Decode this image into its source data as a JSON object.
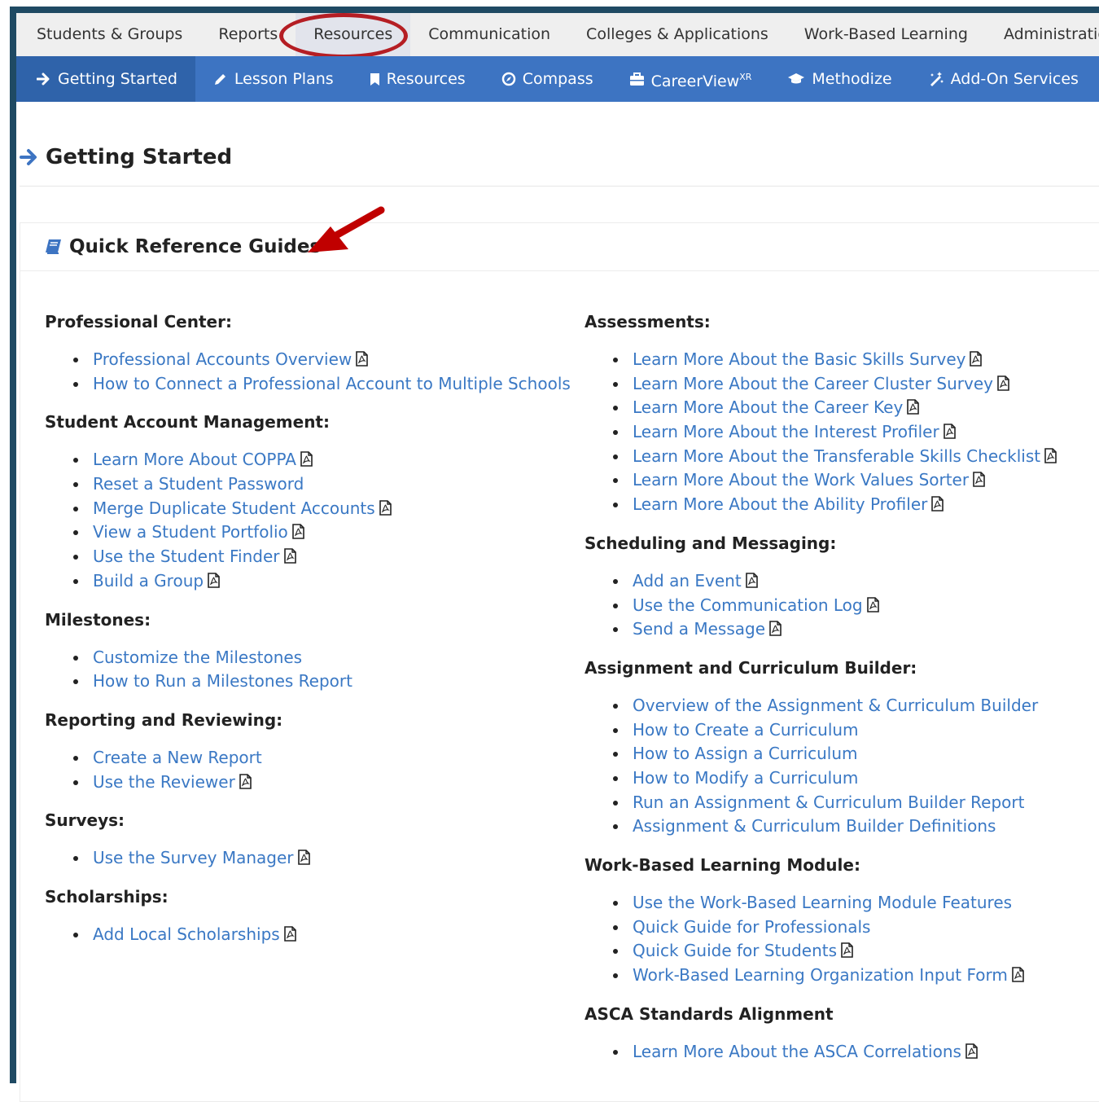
{
  "top_nav": [
    "Students & Groups",
    "Reports",
    "Resources",
    "Communication",
    "Colleges & Applications",
    "Work-Based Learning",
    "Administration"
  ],
  "sub_nav": [
    {
      "label": "Getting Started",
      "icon": "arrow-right-icon"
    },
    {
      "label": "Lesson Plans",
      "icon": "pencil-icon"
    },
    {
      "label": "Resources",
      "icon": "bookmark-icon"
    },
    {
      "label": "Compass",
      "icon": "compass-icon"
    },
    {
      "label": "CareerView",
      "sup": "XR",
      "icon": "briefcase-icon"
    },
    {
      "label": "Methodize",
      "icon": "graduation-cap-icon"
    },
    {
      "label": "Add-On Services",
      "icon": "magic-wand-icon"
    }
  ],
  "page_title": "Getting Started",
  "panel_title": "Quick Reference Guides",
  "colors": {
    "frame": "#1f4a63",
    "subnav": "#3d74c2",
    "link": "#3a78c4",
    "annotation": "#b51e24"
  },
  "left_sections": [
    {
      "heading": "Professional Center:",
      "items": [
        {
          "text": "Professional Accounts Overview",
          "pdf": true
        },
        {
          "text": "How to Connect a Professional Account to Multiple Schools",
          "pdf": false
        }
      ]
    },
    {
      "heading": "Student Account Management:",
      "items": [
        {
          "text": "Learn More About COPPA",
          "pdf": true
        },
        {
          "text": "Reset a Student Password",
          "pdf": false
        },
        {
          "text": "Merge Duplicate Student Accounts",
          "pdf": true
        },
        {
          "text": "View a Student Portfolio",
          "pdf": true
        },
        {
          "text": "Use the Student Finder",
          "pdf": true
        },
        {
          "text": "Build a Group",
          "pdf": true
        }
      ]
    },
    {
      "heading": "Milestones:",
      "items": [
        {
          "text": "Customize the Milestones",
          "pdf": false
        },
        {
          "text": "How to Run a Milestones Report",
          "pdf": false
        }
      ]
    },
    {
      "heading": "Reporting and Reviewing:",
      "items": [
        {
          "text": "Create a New Report",
          "pdf": false
        },
        {
          "text": "Use the Reviewer",
          "pdf": true
        }
      ]
    },
    {
      "heading": "Surveys:",
      "items": [
        {
          "text": "Use the Survey Manager",
          "pdf": true
        }
      ]
    },
    {
      "heading": "Scholarships:",
      "items": [
        {
          "text": "Add Local Scholarships",
          "pdf": true
        }
      ]
    }
  ],
  "right_sections": [
    {
      "heading": "Assessments:",
      "items": [
        {
          "text": "Learn More About the Basic Skills Survey",
          "pdf": true
        },
        {
          "text": "Learn More About the Career Cluster Survey",
          "pdf": true
        },
        {
          "text": "Learn More About the Career Key",
          "pdf": true
        },
        {
          "text": "Learn More About the Interest Profiler",
          "pdf": true
        },
        {
          "text": "Learn More About the Transferable Skills Checklist",
          "pdf": true
        },
        {
          "text": "Learn More About the Work Values Sorter",
          "pdf": true
        },
        {
          "text": "Learn More About the Ability Profiler",
          "pdf": true
        }
      ]
    },
    {
      "heading": "Scheduling and Messaging:",
      "items": [
        {
          "text": "Add an Event",
          "pdf": true
        },
        {
          "text": "Use the Communication Log",
          "pdf": true
        },
        {
          "text": "Send a Message",
          "pdf": true
        }
      ]
    },
    {
      "heading": "Assignment and Curriculum Builder:",
      "items": [
        {
          "text": "Overview of the Assignment & Curriculum Builder",
          "pdf": false
        },
        {
          "text": "How to Create a Curriculum",
          "pdf": false
        },
        {
          "text": "How to Assign a Curriculum",
          "pdf": false
        },
        {
          "text": "How to Modify a Curriculum",
          "pdf": false
        },
        {
          "text": "Run an Assignment & Curriculum Builder Report",
          "pdf": false
        },
        {
          "text": "Assignment & Curriculum Builder Definitions",
          "pdf": false
        }
      ]
    },
    {
      "heading": "Work-Based Learning Module:",
      "items": [
        {
          "text": "Use the Work-Based Learning Module Features",
          "pdf": false
        },
        {
          "text": "Quick Guide for Professionals",
          "pdf": false
        },
        {
          "text": "Quick Guide for Students",
          "pdf": true
        },
        {
          "text": "Work-Based Learning Organization Input Form",
          "pdf": true
        }
      ]
    },
    {
      "heading": "ASCA Standards Alignment",
      "items": [
        {
          "text": "Learn More About the ASCA Correlations",
          "pdf": true
        }
      ]
    }
  ]
}
